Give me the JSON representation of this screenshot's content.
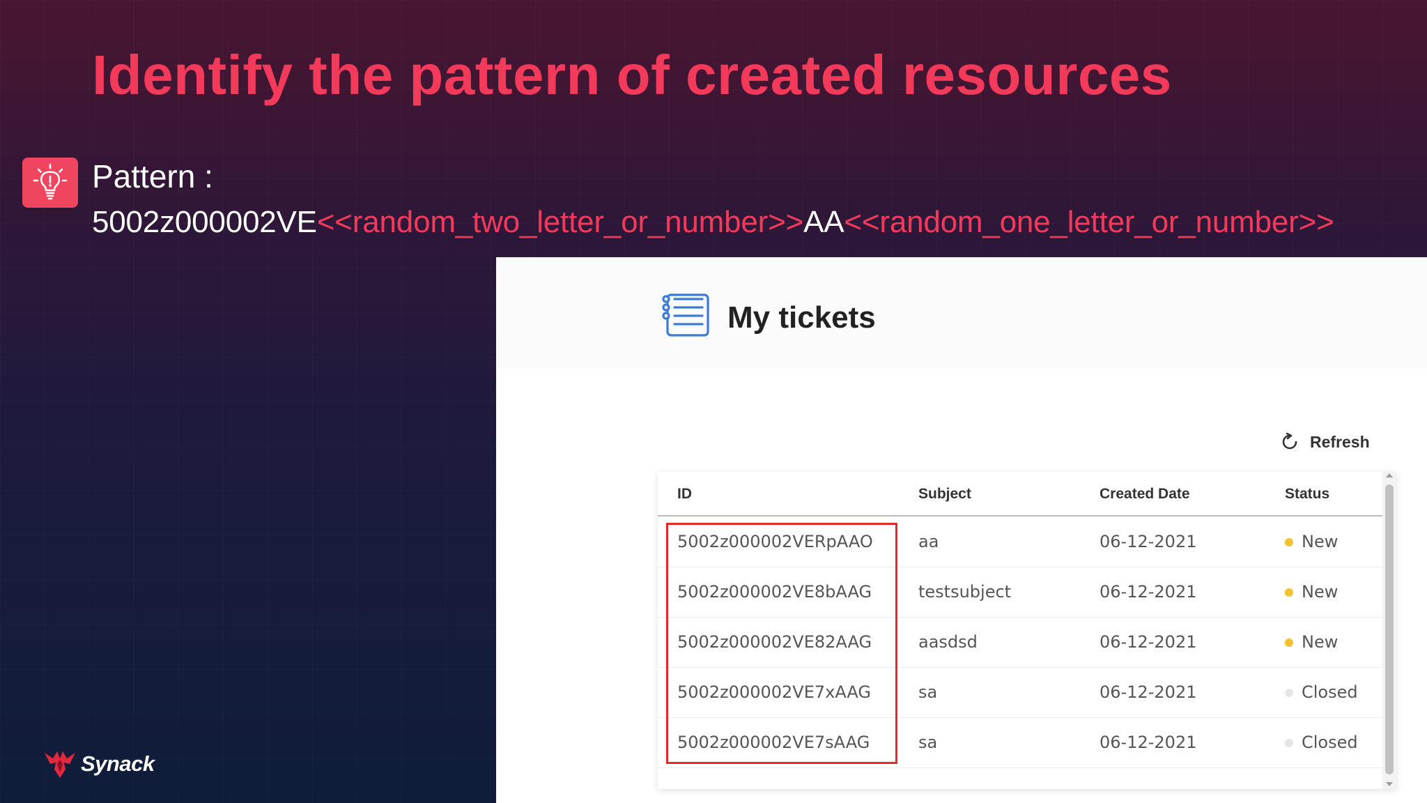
{
  "slide": {
    "title": "Identify the pattern of created resources",
    "pattern_label": "Pattern :",
    "pattern": {
      "prefix": "5002z000002VE",
      "part_two": "<<random_two_letter_or_number>>",
      "middle": "AA",
      "part_one": "<<random_one_letter_or_number>>"
    },
    "brand": "Synack",
    "icons": {
      "badge": "lightbulb-icon",
      "brand": "synack-logo-icon"
    }
  },
  "app": {
    "page_title": "My tickets",
    "refresh_label": "Refresh",
    "columns": {
      "id": "ID",
      "subject": "Subject",
      "created_date": "Created Date",
      "status": "Status"
    },
    "rows": [
      {
        "id": "5002z000002VERpAAO",
        "subject": "aa",
        "created": "06-12-2021",
        "status": "New",
        "status_color": "#f2c230"
      },
      {
        "id": "5002z000002VE8bAAG",
        "subject": "testsubject",
        "created": "06-12-2021",
        "status": "New",
        "status_color": "#f2c230"
      },
      {
        "id": "5002z000002VE82AAG",
        "subject": "aasdsd",
        "created": "06-12-2021",
        "status": "New",
        "status_color": "#f2c230"
      },
      {
        "id": "5002z000002VE7xAAG",
        "subject": "sa",
        "created": "06-12-2021",
        "status": "Closed",
        "status_color": "#e6e6e6"
      },
      {
        "id": "5002z000002VE7sAAG",
        "subject": "sa",
        "created": "06-12-2021",
        "status": "Closed",
        "status_color": "#e6e6e6"
      }
    ]
  },
  "colors": {
    "accent_red": "#f43a5a",
    "highlight_border": "#e32a2a",
    "status_new": "#f2c230",
    "status_closed": "#e6e6e6"
  }
}
